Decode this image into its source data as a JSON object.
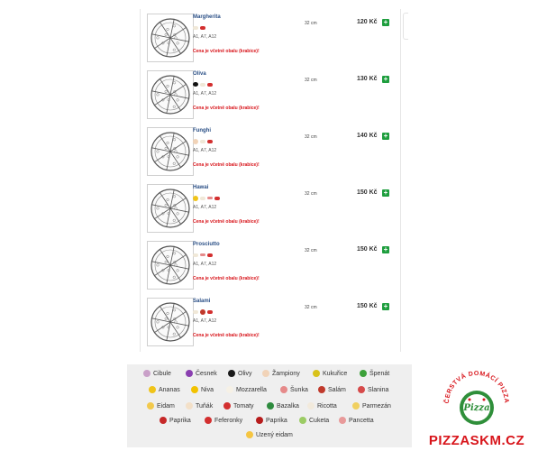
{
  "menu": {
    "items": [
      {
        "name": "Margherita",
        "allergens": "A1, A7, A12",
        "note": "Cena je včetně obalu (krabice)!",
        "size": "32 cm",
        "price": "120 Kč",
        "add": "+"
      },
      {
        "name": "Oliva",
        "allergens": "A1, A7, A12",
        "note": "Cena je včetně obalu (krabice)!",
        "size": "32 cm",
        "price": "130 Kč",
        "add": "+"
      },
      {
        "name": "Funghi",
        "allergens": "A1, A7, A12",
        "note": "Cena je včetně obalu (krabice)!",
        "size": "32 cm",
        "price": "140 Kč",
        "add": "+"
      },
      {
        "name": "Hawai",
        "allergens": "A1, A7, A12",
        "note": "Cena je včetně obalu (krabice)!",
        "size": "32 cm",
        "price": "150 Kč",
        "add": "+"
      },
      {
        "name": "Prosciutto",
        "allergens": "A1, A7, A12",
        "note": "Cena je včetně obalu (krabice)!",
        "size": "32 cm",
        "price": "150 Kč",
        "add": "+"
      },
      {
        "name": "Salami",
        "allergens": "A1, A7, A12",
        "note": "Cena je včetně obalu (krabice)!",
        "size": "32 cm",
        "price": "150 Kč",
        "add": "+"
      }
    ]
  },
  "legend": {
    "items": [
      "Cibule",
      "Česnek",
      "Olivy",
      "Žampiony",
      "Kukuřice",
      "Špenát",
      "Ananas",
      "Niva",
      "Mozzarella",
      "Šunka",
      "Salám",
      "Slanina",
      "Eidam",
      "Tuňák",
      "Tomaty",
      "Bazalka",
      "Ricotta",
      "Parmezán",
      "Paprika",
      "Feferonky",
      "Paprika",
      "Cuketa",
      "Pancetta",
      "Uzený eidam"
    ],
    "colors": [
      "#c9a0c8",
      "#8a3fb0",
      "#1a1a1a",
      "#f1d3b8",
      "#d8c21a",
      "#3ca03a",
      "#f0c419",
      "#f2c200",
      "#f6f1e6",
      "#e68a8a",
      "#c0392b",
      "#d64a4a",
      "#f2c94c",
      "#f3e0c8",
      "#d32f2f",
      "#2e8b3e",
      "#f2eadc",
      "#f0d060",
      "#c62828",
      "#d32f2f",
      "#b71c1c",
      "#9ccc65",
      "#e89a9a",
      "#f5c542"
    ]
  },
  "logo": {
    "arc_text": "ČERSTVÁ DOMÁCÍ PIZZA",
    "badge_text": "Pizza",
    "site": "PIZZASKM.CZ"
  }
}
